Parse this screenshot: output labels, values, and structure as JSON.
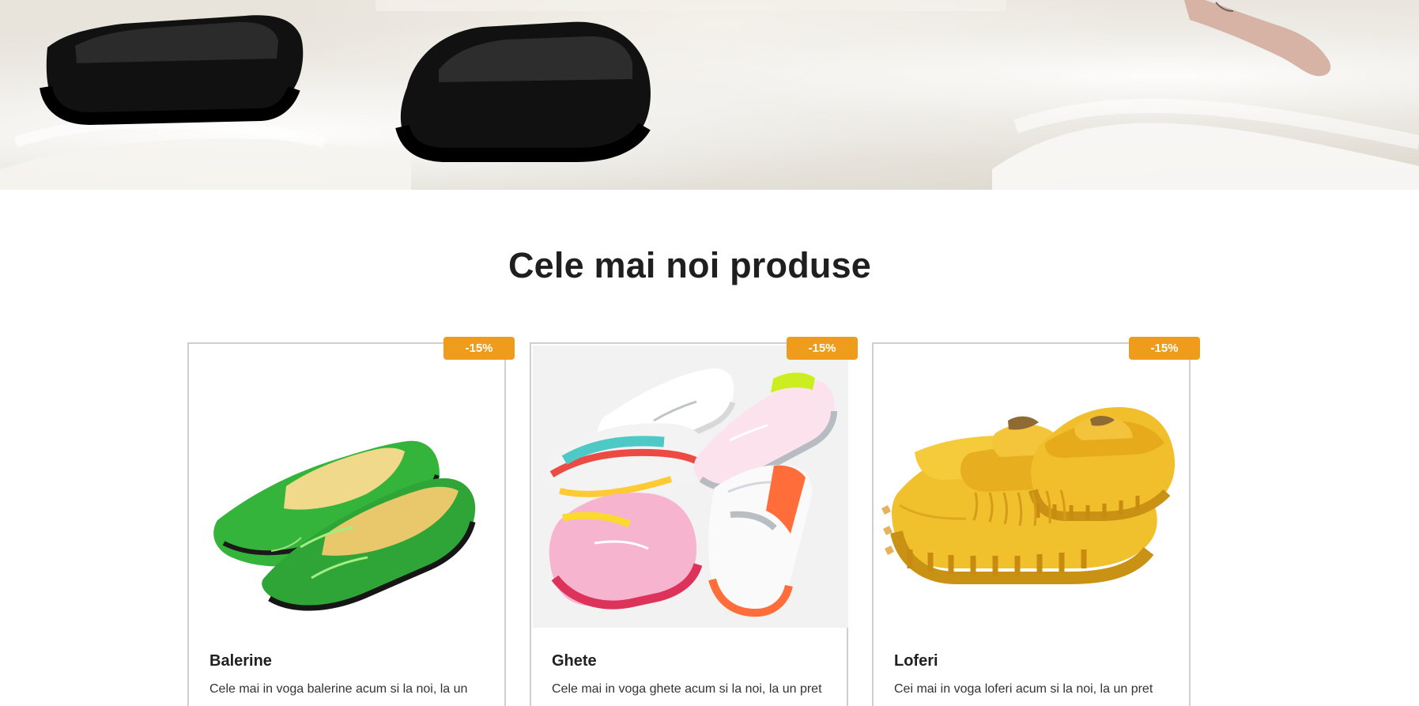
{
  "section": {
    "title": "Cele mai noi produse"
  },
  "products": [
    {
      "name": "Balerine",
      "discount": "-15%",
      "description": "Cele mai in voga balerine acum si la noi, la un"
    },
    {
      "name": "Ghete",
      "discount": "-15%",
      "description": "Cele mai in voga ghete acum si la noi, la un pret"
    },
    {
      "name": "Loferi",
      "discount": "-15%",
      "description": "Cei mai in voga loferi acum si la noi, la un pret"
    }
  ],
  "colors": {
    "accent": "#ef9b1b",
    "border": "#cfcfcf",
    "text": "#1f1f1f"
  }
}
